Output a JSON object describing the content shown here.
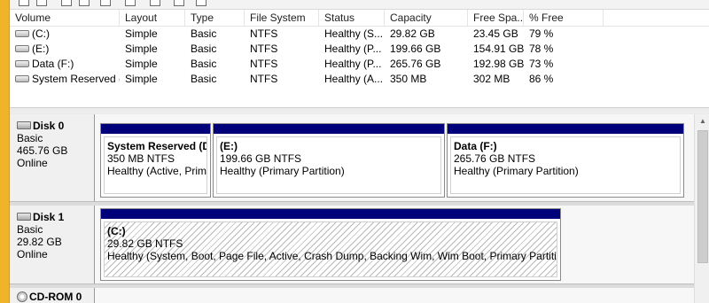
{
  "volume_table": {
    "columns": [
      "Volume",
      "Layout",
      "Type",
      "File System",
      "Status",
      "Capacity",
      "Free Spa...",
      "% Free"
    ],
    "rows": [
      {
        "volume": "(C:)",
        "layout": "Simple",
        "type": "Basic",
        "fs": "NTFS",
        "status": "Healthy (S...",
        "capacity": "29.82 GB",
        "free": "23.45 GB",
        "pct": "79 %"
      },
      {
        "volume": "(E:)",
        "layout": "Simple",
        "type": "Basic",
        "fs": "NTFS",
        "status": "Healthy (P...",
        "capacity": "199.66 GB",
        "free": "154.91 GB",
        "pct": "78 %"
      },
      {
        "volume": "Data (F:)",
        "layout": "Simple",
        "type": "Basic",
        "fs": "NTFS",
        "status": "Healthy (P...",
        "capacity": "265.76 GB",
        "free": "192.98 GB",
        "pct": "73 %"
      },
      {
        "volume": "System Reserved (...",
        "layout": "Simple",
        "type": "Basic",
        "fs": "NTFS",
        "status": "Healthy (A...",
        "capacity": "350 MB",
        "free": "302 MB",
        "pct": "86 %"
      }
    ]
  },
  "disks": [
    {
      "name": "Disk 0",
      "type": "Basic",
      "size": "465.76 GB",
      "state": "Online",
      "partitions": [
        {
          "name": "System Reserved  (D",
          "size": "350 MB NTFS",
          "status": "Healthy (Active, Prima"
        },
        {
          "name": "(E:)",
          "size": "199.66 GB NTFS",
          "status": "Healthy (Primary Partition)"
        },
        {
          "name": "Data  (F:)",
          "size": "265.76 GB NTFS",
          "status": "Healthy (Primary Partition)"
        }
      ]
    },
    {
      "name": "Disk 1",
      "type": "Basic",
      "size": "29.82 GB",
      "state": "Online",
      "partitions": [
        {
          "name": "(C:)",
          "size": "29.82 GB NTFS",
          "status": "Healthy (System, Boot, Page File, Active, Crash Dump, Backing Wim, Wim Boot, Primary Partition)"
        }
      ]
    },
    {
      "name": "CD-ROM 0"
    }
  ],
  "colors": {
    "primary_partition_bar": "#00007b",
    "window_background": "#f0b429"
  },
  "icons": {
    "volume": "drive-icon",
    "disk": "disk-icon",
    "cdrom": "cdrom-icon"
  }
}
